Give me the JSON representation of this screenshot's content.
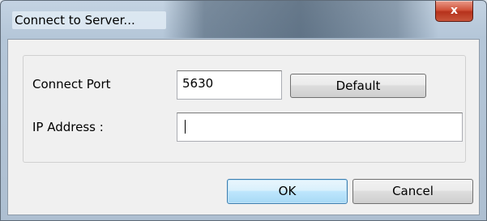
{
  "window": {
    "title": "Connect to Server...",
    "close_label": "x"
  },
  "form": {
    "connect_port_label": "Connect Port",
    "connect_port_value": "5630",
    "default_button": "Default",
    "ip_address_label": "IP Address :",
    "ip_address_value": ""
  },
  "buttons": {
    "ok": "OK",
    "cancel": "Cancel"
  }
}
